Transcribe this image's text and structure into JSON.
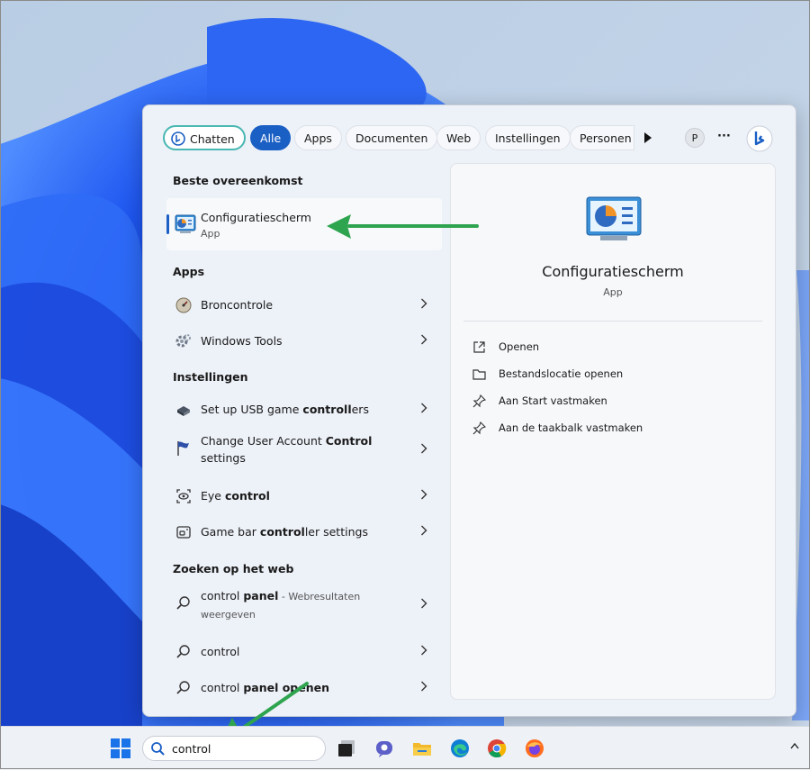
{
  "filters": [
    {
      "label": "Chatten",
      "style": "chat"
    },
    {
      "label": "Alle",
      "style": "active"
    },
    {
      "label": "Apps",
      "style": "normal"
    },
    {
      "label": "Documenten",
      "style": "normal"
    },
    {
      "label": "Web",
      "style": "normal"
    },
    {
      "label": "Instellingen",
      "style": "normal"
    },
    {
      "label": "Personen",
      "style": "normal"
    }
  ],
  "profile_initial": "P",
  "more_glyph": "···",
  "best_match": {
    "heading": "Beste overeenkomst",
    "title": "Configuratiescherm",
    "subtitle": "App"
  },
  "apps": {
    "heading": "Apps",
    "items": [
      {
        "icon": "resource-monitor-icon",
        "label": "Broncontrole"
      },
      {
        "icon": "windows-tools-icon",
        "label": "Windows Tools"
      }
    ]
  },
  "settings": {
    "heading": "Instellingen",
    "items": [
      {
        "icon": "usb-controller-icon",
        "pre": "Set up USB game ",
        "bold": "controll",
        "post": "ers"
      },
      {
        "icon": "uac-flag-icon",
        "pre": "Change User Account ",
        "bold": "Control",
        "post": "",
        "line2": "settings"
      },
      {
        "icon": "eye-control-icon",
        "pre": "Eye ",
        "bold": "control",
        "post": ""
      },
      {
        "icon": "game-bar-icon",
        "pre": "Game bar ",
        "bold": "control",
        "post": "ler settings"
      }
    ]
  },
  "web": {
    "heading": "Zoeken op het web",
    "items": [
      {
        "icon": "search-icon",
        "pre": "control ",
        "bold": "panel",
        "post": "",
        "sub": " - Webresultaten",
        "line2": "weergeven"
      },
      {
        "icon": "search-icon",
        "pre": "control",
        "bold": "",
        "post": ""
      },
      {
        "icon": "search-icon",
        "pre": "control ",
        "bold": "panel openen",
        "post": ""
      }
    ]
  },
  "preview": {
    "title": "Configuratiescherm",
    "subtitle": "App",
    "actions": [
      {
        "icon": "open-icon",
        "label": "Openen"
      },
      {
        "icon": "folder-icon",
        "label": "Bestandslocatie openen"
      },
      {
        "icon": "pin-icon",
        "label": "Aan Start vastmaken"
      },
      {
        "icon": "pin-icon",
        "label": "Aan de taakbalk vastmaken"
      }
    ]
  },
  "taskbar": {
    "search_value": "control",
    "apps": [
      "task-view-icon",
      "teams-icon",
      "file-explorer-icon",
      "edge-icon",
      "chrome-icon",
      "firefox-icon"
    ]
  },
  "colors": {
    "accent": "#1a5fc4",
    "annotation_arrow": "#2ea44f"
  }
}
